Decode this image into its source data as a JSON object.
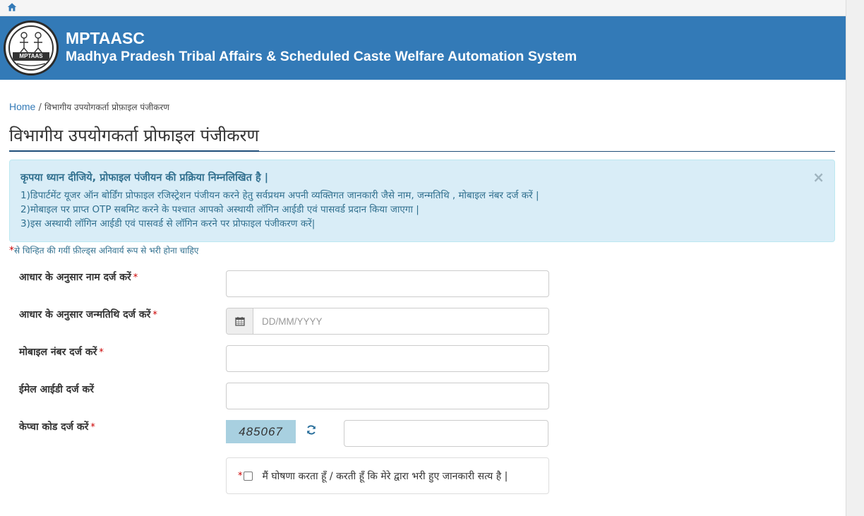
{
  "brand": {
    "title": "MPTAASC",
    "subtitle": "Madhya Pradesh Tribal Affairs & Scheduled Caste Welfare Automation System",
    "logo_text": "MPTAAS"
  },
  "breadcrumb": {
    "home": "Home",
    "separator": "/",
    "current": "विभागीय उपयोगकर्ता प्रोफ़ाइल पंजीकरण"
  },
  "page_title": "विभागीय उपयोगकर्ता प्रोफाइल पंजीकरण",
  "notice": {
    "heading": "कृपया ध्यान दीजिये, प्रोफाइल पंजीयन की प्रक्रिया निम्नलिखित है |",
    "lines": [
      "1)डिपार्टमेंट यूजर ऑन बोर्डिंग प्रोफाइल रजिस्ट्रेशन पंजीयन करने हेतु सर्वप्रथम अपनी व्यक्तिगत जानकारी जैसे नाम, जन्मतिथि , मोबाइल नंबर दर्ज करें |",
      "2)मोबाइल पर प्राप्त OTP सबमिट करने के पश्चात आपको अस्थायी लॉगिन आईडी एवं पासवर्ड प्रदान किया जाएगा |",
      "3)इस अस्थायी लॉगिन आईडी एवं पासवर्ड से लॉगिन करने पर प्रोफाइल पंजीकरण करें|"
    ],
    "close": "×"
  },
  "required_note": {
    "star": "*",
    "text": "से चिन्हित की गयीं फ़ील्ड्स अनिवार्य रूप से भरी होना चाहिए"
  },
  "form": {
    "name_label": "आधार के अनुसार नाम दर्ज करें",
    "dob_label": "आधार के अनुसार जन्मतिथि दर्ज करें",
    "dob_placeholder": "DD/MM/YYYY",
    "mobile_label": "मोबाइल नंबर दर्ज करें",
    "email_label": "ईमेल आईडी दर्ज करें",
    "captcha_label": "केप्चा कोड दर्ज करें",
    "captcha_code": "485067",
    "required_star": "*",
    "declaration": "मैं घोषणा करता हूँ / करती हूँ कि मेरे द्वारा भरी हुए जानकारी सत्य है |"
  },
  "colors": {
    "header_bg": "#337ab7",
    "alert_bg": "#d9edf7",
    "alert_text": "#31708f",
    "captcha_bg": "#a8d0e0",
    "required": "#cc0000"
  },
  "icons": [
    "home-icon",
    "calendar-icon",
    "refresh-icon",
    "close-icon"
  ]
}
